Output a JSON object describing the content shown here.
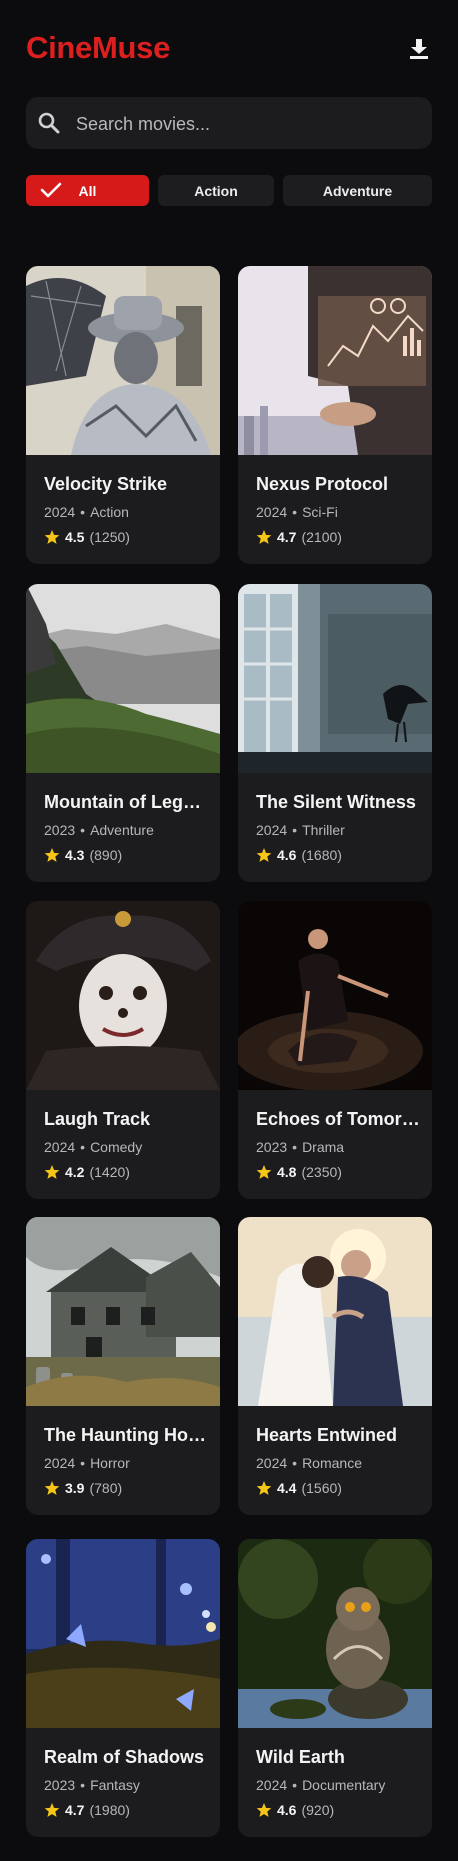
{
  "app": {
    "title": "CineMuse"
  },
  "header": {
    "download_icon": "download-icon"
  },
  "search": {
    "placeholder": "Search movies...",
    "value": ""
  },
  "filters": [
    {
      "label": "All",
      "active": true
    },
    {
      "label": "Action",
      "active": false
    },
    {
      "label": "Adventure",
      "active": false
    }
  ],
  "colors": {
    "brand": "#dd1f1f",
    "star": "#f5c518",
    "card_bg": "#1c1c1f",
    "bg": "#0c0c0e"
  },
  "movies": [
    {
      "title": "Velocity Strike",
      "year": "2024",
      "genre": "Action",
      "rating": "4.5",
      "count": "(1250)"
    },
    {
      "title": "Nexus Protocol",
      "year": "2024",
      "genre": "Sci-Fi",
      "rating": "4.7",
      "count": "(2100)"
    },
    {
      "title": "Mountain of Legends",
      "year": "2023",
      "genre": "Adventure",
      "rating": "4.3",
      "count": "(890)"
    },
    {
      "title": "The Silent Witness",
      "year": "2024",
      "genre": "Thriller",
      "rating": "4.6",
      "count": "(1680)"
    },
    {
      "title": "Laugh Track",
      "year": "2024",
      "genre": "Comedy",
      "rating": "4.2",
      "count": "(1420)"
    },
    {
      "title": "Echoes of Tomorrow",
      "year": "2023",
      "genre": "Drama",
      "rating": "4.8",
      "count": "(2350)"
    },
    {
      "title": "The Haunting Hollow",
      "year": "2024",
      "genre": "Horror",
      "rating": "3.9",
      "count": "(780)"
    },
    {
      "title": "Hearts Entwined",
      "year": "2024",
      "genre": "Romance",
      "rating": "4.4",
      "count": "(1560)"
    },
    {
      "title": "Realm of Shadows",
      "year": "2023",
      "genre": "Fantasy",
      "rating": "4.7",
      "count": "(1980)"
    },
    {
      "title": "Wild Earth",
      "year": "2024",
      "genre": "Documentary",
      "rating": "4.6",
      "count": "(920)"
    }
  ]
}
